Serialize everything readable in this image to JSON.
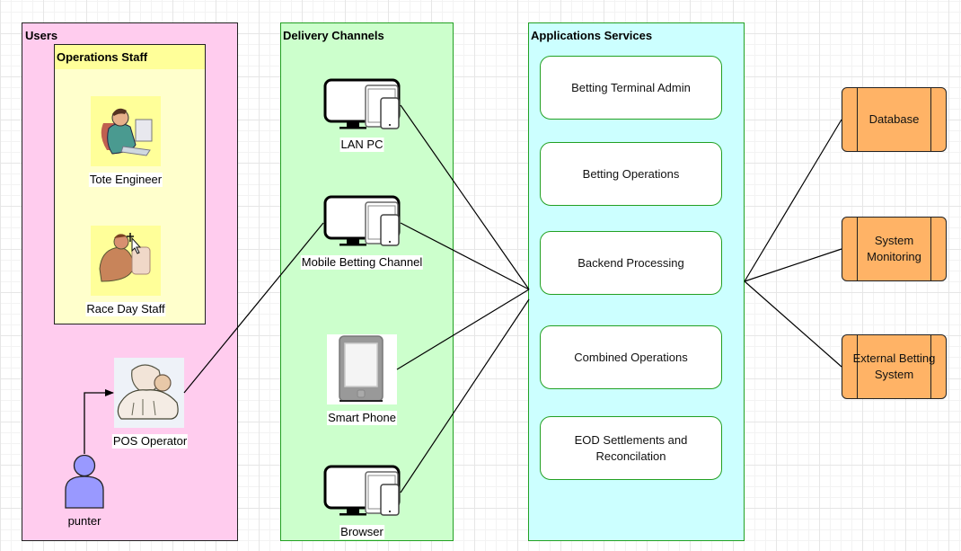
{
  "containers": {
    "users": {
      "title": "Users",
      "fill": "#ffccee"
    },
    "operations_staff": {
      "title": "Operations Staff",
      "header_fill": "#ffff99",
      "fill": "#ffffcc"
    },
    "delivery_channels": {
      "title": "Delivery Channels",
      "fill": "#ccffcc"
    },
    "applications_services": {
      "title": "Applications Services",
      "fill": "#ccffff"
    }
  },
  "actors": [
    {
      "id": "tote-engineer",
      "label": "Tote Engineer",
      "icon": "engineer-at-computer-icon"
    },
    {
      "id": "race-day-staff",
      "label": "Race Day Staff",
      "icon": "staff-at-computer-icon"
    },
    {
      "id": "pos-operator",
      "label": "POS Operator",
      "icon": "pos-operator-icon"
    },
    {
      "id": "punter",
      "label": "punter",
      "icon": "person-icon"
    }
  ],
  "channels": [
    {
      "id": "lan-pc",
      "label": "LAN PC",
      "icon": "multi-device-icon"
    },
    {
      "id": "mobile-betting-channel",
      "label": "Mobile Betting Channel",
      "icon": "multi-device-icon"
    },
    {
      "id": "smart-phone",
      "label": "Smart Phone",
      "icon": "tablet-phone-icon"
    },
    {
      "id": "browser",
      "label": "Browser",
      "icon": "multi-device-icon"
    }
  ],
  "services": [
    {
      "id": "betting-terminal-admin",
      "label": "Betting Terminal Admin"
    },
    {
      "id": "betting-operations",
      "label": "Betting Operations"
    },
    {
      "id": "backend-processing",
      "label": "Backend Processing"
    },
    {
      "id": "combined-operations",
      "label": "Combined Operations"
    },
    {
      "id": "eod-settlements",
      "label": "EOD Settlements and Reconcilation"
    }
  ],
  "external_systems": [
    {
      "id": "database",
      "label": "Database"
    },
    {
      "id": "system-monitoring",
      "label": "System Monitoring"
    },
    {
      "id": "external-betting-system",
      "label": "External Betting System"
    }
  ],
  "connections": [
    {
      "from": "punter",
      "to": "pos-operator",
      "arrow": true
    },
    {
      "from": "pos-operator",
      "to": "mobile-betting-channel"
    },
    {
      "from": "lan-pc",
      "to": "applications-services"
    },
    {
      "from": "mobile-betting-channel",
      "to": "applications-services"
    },
    {
      "from": "smart-phone",
      "to": "applications-services"
    },
    {
      "from": "browser",
      "to": "applications-services"
    },
    {
      "from": "applications-services",
      "to": "database"
    },
    {
      "from": "applications-services",
      "to": "system-monitoring"
    },
    {
      "from": "applications-services",
      "to": "external-betting-system"
    }
  ],
  "colors": {
    "service_border": "#22a022",
    "external_fill": "#ffb366",
    "punter_fill": "#9999ff"
  }
}
